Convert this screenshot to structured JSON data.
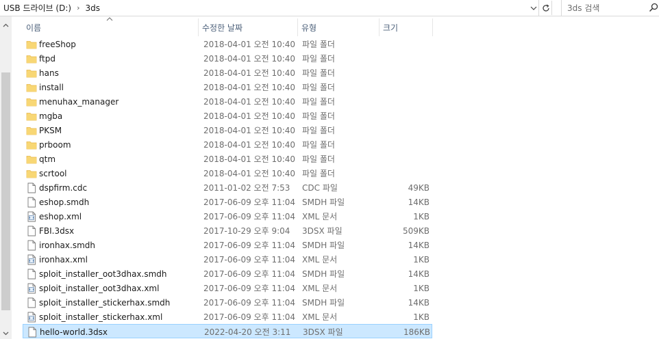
{
  "address": {
    "segments": [
      "USB 드라이브 (D:)",
      "3ds"
    ],
    "separator": "›"
  },
  "search": {
    "placeholder": "3ds 검색"
  },
  "columns": {
    "name": "이름",
    "date": "수정한 날짜",
    "type": "유형",
    "size": "크기"
  },
  "files": [
    {
      "kind": "folder",
      "name": "freeShop",
      "date": "2018-04-01 오전 10:40",
      "type": "파일 폴더",
      "size": ""
    },
    {
      "kind": "folder",
      "name": "ftpd",
      "date": "2018-04-01 오전 10:40",
      "type": "파일 폴더",
      "size": ""
    },
    {
      "kind": "folder",
      "name": "hans",
      "date": "2018-04-01 오전 10:40",
      "type": "파일 폴더",
      "size": ""
    },
    {
      "kind": "folder",
      "name": "install",
      "date": "2018-04-01 오전 10:40",
      "type": "파일 폴더",
      "size": ""
    },
    {
      "kind": "folder",
      "name": "menuhax_manager",
      "date": "2018-04-01 오전 10:40",
      "type": "파일 폴더",
      "size": ""
    },
    {
      "kind": "folder",
      "name": "mgba",
      "date": "2018-04-01 오전 10:40",
      "type": "파일 폴더",
      "size": ""
    },
    {
      "kind": "folder",
      "name": "PKSM",
      "date": "2018-04-01 오전 10:40",
      "type": "파일 폴더",
      "size": ""
    },
    {
      "kind": "folder",
      "name": "prboom",
      "date": "2018-04-01 오전 10:40",
      "type": "파일 폴더",
      "size": ""
    },
    {
      "kind": "folder",
      "name": "qtm",
      "date": "2018-04-01 오전 10:40",
      "type": "파일 폴더",
      "size": ""
    },
    {
      "kind": "folder",
      "name": "scrtool",
      "date": "2018-04-01 오전 10:40",
      "type": "파일 폴더",
      "size": ""
    },
    {
      "kind": "file",
      "name": "dspfirm.cdc",
      "date": "2011-01-02 오전 7:53",
      "type": "CDC 파일",
      "size": "49KB"
    },
    {
      "kind": "file",
      "name": "eshop.smdh",
      "date": "2017-06-09 오후 11:04",
      "type": "SMDH 파일",
      "size": "14KB"
    },
    {
      "kind": "xml",
      "name": "eshop.xml",
      "date": "2017-06-09 오후 11:04",
      "type": "XML 문서",
      "size": "1KB"
    },
    {
      "kind": "file",
      "name": "FBI.3dsx",
      "date": "2017-10-29 오후 9:04",
      "type": "3DSX 파일",
      "size": "509KB"
    },
    {
      "kind": "file",
      "name": "ironhax.smdh",
      "date": "2017-06-09 오후 11:04",
      "type": "SMDH 파일",
      "size": "14KB"
    },
    {
      "kind": "xml",
      "name": "ironhax.xml",
      "date": "2017-06-09 오후 11:04",
      "type": "XML 문서",
      "size": "1KB"
    },
    {
      "kind": "file",
      "name": "sploit_installer_oot3dhax.smdh",
      "date": "2017-06-09 오후 11:04",
      "type": "SMDH 파일",
      "size": "14KB"
    },
    {
      "kind": "xml",
      "name": "sploit_installer_oot3dhax.xml",
      "date": "2017-06-09 오후 11:04",
      "type": "XML 문서",
      "size": "1KB"
    },
    {
      "kind": "file",
      "name": "sploit_installer_stickerhax.smdh",
      "date": "2017-06-09 오후 11:04",
      "type": "SMDH 파일",
      "size": "14KB"
    },
    {
      "kind": "xml",
      "name": "sploit_installer_stickerhax.xml",
      "date": "2017-06-09 오후 11:04",
      "type": "XML 문서",
      "size": "1KB"
    },
    {
      "kind": "file",
      "name": "hello-world.3dsx",
      "date": "2022-04-20 오전 3:11",
      "type": "3DSX 파일",
      "size": "186KB",
      "selected": true
    }
  ],
  "colors": {
    "folder": "#f8d775",
    "folder_dark": "#e8b84a",
    "selection_bg": "#cce8ff",
    "selection_border": "#99d1ff",
    "header_text": "#4c607a"
  }
}
